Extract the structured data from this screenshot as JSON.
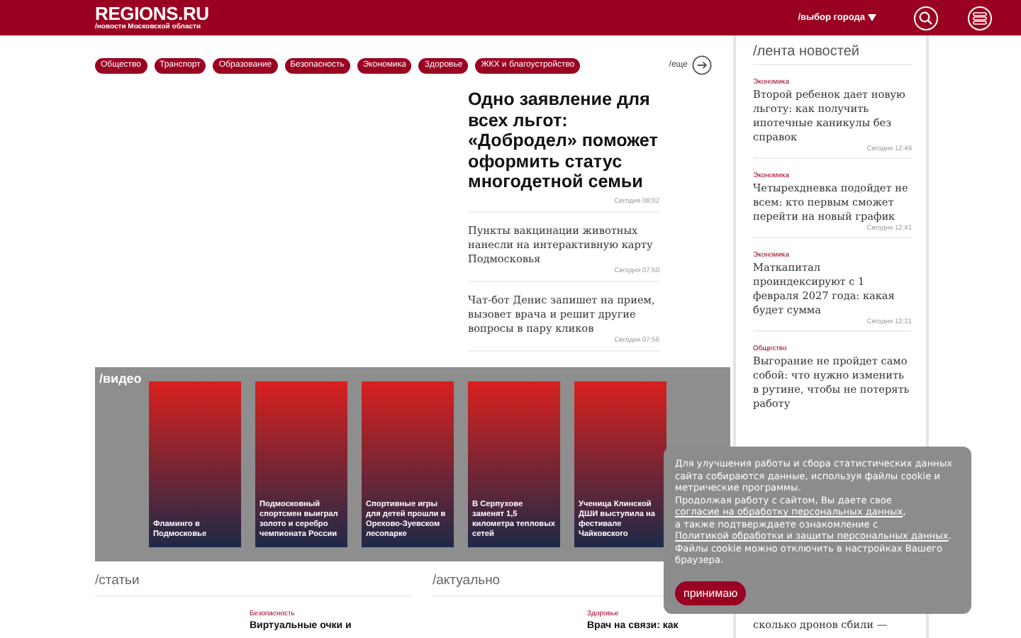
{
  "header": {
    "logo": "REGIONS.RU",
    "subtitle": "/новости Московской области",
    "city_selector": "/выбор города"
  },
  "tags": [
    "Общество",
    "Транспорт",
    "Образование",
    "Безопасность",
    "Экономика",
    "Здоровье",
    "ЖКХ и благоустройство"
  ],
  "more_link": "/еще",
  "lead": {
    "title": "Одно заявление для всех льгот: «Добродел» поможет оформить статус многодетной семьи",
    "time": "Сегодня 08:02"
  },
  "news": [
    {
      "title": "Пункты вакцинации животных нанесли на интерактивную карту Подмосковья",
      "time": "Сегодня 07:50"
    },
    {
      "title": "Чат-бот Денис запишет на прием, вызовет врача и решит другие вопросы в пару кликов",
      "time": "Сегодня 07:56"
    }
  ],
  "video": {
    "title": "/видео",
    "items": [
      {
        "title": "Фламинго в Подмосковье"
      },
      {
        "title": "Подмосковный спортсмен выиграл золото и серебро чемпионата России"
      },
      {
        "title": "Спортивные игры для детей прошли в Орехово-Зуевском лесопарке"
      },
      {
        "title": "В Серпухове заменят 1,5 километра тепловых сетей"
      },
      {
        "title": "Ученица Клинской ДШИ выступила на фестивале Чайковского"
      }
    ]
  },
  "sections": [
    {
      "title": "/статьи",
      "items": [
        {
          "category": "Безопасность",
          "title": "Виртуальные очки и"
        }
      ]
    },
    {
      "title": "/актуально",
      "items": [
        {
          "category": "Здоровье",
          "title": "Врач на связи: как"
        }
      ]
    }
  ],
  "sidebar": {
    "title": "/лента новостей",
    "items": [
      {
        "category": "Экономика",
        "title": "Второй ребенок дает новую льготу: как получить ипотечные каникулы без справок",
        "time": "Сегодня 12:49"
      },
      {
        "category": "Экономика",
        "title": "Четырехдневка подойдет не всем: кто первым сможет перейти на новый график",
        "time": "Сегодня 12:41"
      },
      {
        "category": "Экономика",
        "title": "Маткапитал проиндексируют с 1 февраля 2027 года: какая будет сумма",
        "time": "Сегодня 12:31"
      },
      {
        "category": "Общество",
        "title": "Выгорание не пройдет само собой: что нужно изменить в рутине, чтобы не потерять работу"
      },
      {
        "title": "сколько дронов сбили —"
      }
    ]
  },
  "cookie": {
    "paragraphs": [
      {
        "text": "Для улучшения работы и сбора статистических данных сайта собираются данные, используя файлы cookie и метрические программы."
      },
      {
        "text": "Продолжая работу с сайтом, Вы даете свое ",
        "link": "согласие на обработку персональных данных",
        "after": ","
      },
      {
        "text": "а также подтверждаете ознакомление с ",
        "link": "Политикой обработки и защиты персональных данных",
        "after": ". Файлы cookie можно отключить в настройках Вашего браузера."
      }
    ],
    "button": "принимаю"
  }
}
